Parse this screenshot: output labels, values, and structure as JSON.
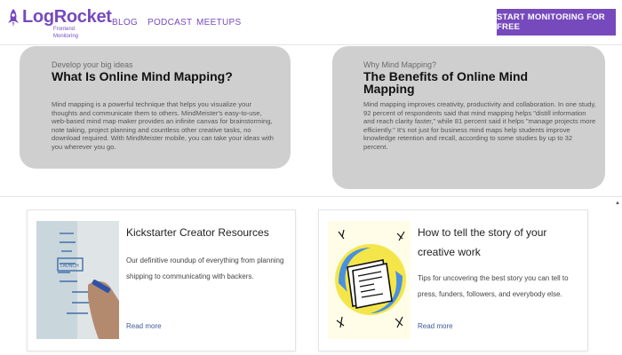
{
  "header": {
    "logo_text": "LogRocket",
    "logo_subtitle": "Frontend Monitoring",
    "nav": [
      "BLOG",
      "PODCAST",
      "MEETUPS"
    ],
    "cta_label": "START MONITORING FOR FREE"
  },
  "info_cards": [
    {
      "eyebrow": "Develop your big ideas",
      "title": "What Is Online Mind Mapping?",
      "body": "Mind mapping is a powerful technique that helps you visualize your thoughts and communicate them to others. MindMeister's easy-to-use, web-based mind map maker provides an infinite canvas for brainstorming, note taking, project planning and countless other creative tasks, no download required. With MindMeister mobile, you can take your ideas with you wherever you go."
    },
    {
      "eyebrow": "Why Mind Mapping?",
      "title": "The Benefits of Online Mind Mapping",
      "body": "Mind mapping improves creativity, productivity and collaboration. In one study, 92 percent of respondents said that mind mapping helps \"distill information and reach clarity faster,\" while 81 percent said it helps \"manage projects more efficiently.\" It's not just for business mind maps help students improve knowledge retention and recall, according to some studies by up to 32 percent."
    }
  ],
  "resources": [
    {
      "title": "Kickstarter Creator Resources",
      "description": "Our definitive roundup of everything from planning shipping to communicating with backers.",
      "link": "Read more",
      "image_icon": "whiteboard-photo"
    },
    {
      "title": "How to tell the story of your creative work",
      "description": "Tips for uncovering the best story you can tell to press, funders, followers, and everybody else.",
      "link": "Read more",
      "image_icon": "newspaper-illustration"
    }
  ],
  "colors": {
    "brand": "#764abc",
    "card_bg": "#cfcfcf",
    "link": "#3d5a99"
  }
}
